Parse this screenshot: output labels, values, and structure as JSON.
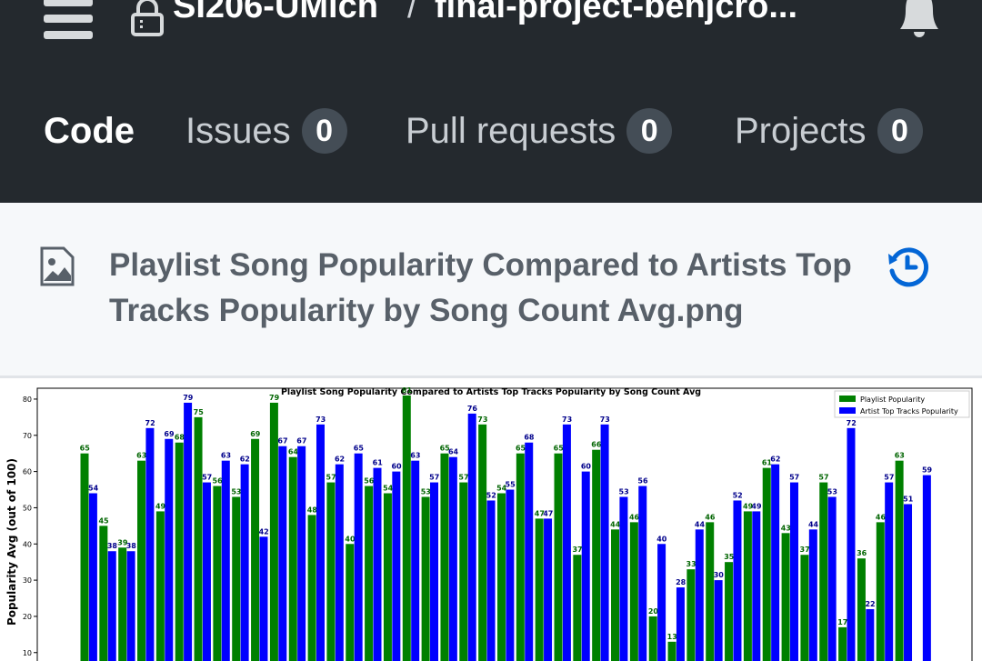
{
  "header": {
    "repo_owner": "SI206-UMich",
    "separator": "/",
    "repo_name": "final-project-benjcro..."
  },
  "tabs": [
    {
      "label": "Code",
      "active": true
    },
    {
      "label": "Issues",
      "count": "0"
    },
    {
      "label": "Pull requests",
      "count": "0"
    },
    {
      "label": "Projects",
      "count": "0"
    }
  ],
  "file": {
    "name": "Playlist Song Popularity Compared to Artists Top Tracks Popularity by Song Count Avg.png"
  },
  "colors": {
    "header_bg": "#24292e",
    "playlist_bar": "#008000",
    "artist_bar": "#0000ff",
    "history_icon": "#0366d6"
  },
  "chart_data": {
    "type": "bar",
    "title": "Playlist Song Popularity Compared to Artists Top Tracks Popularity by Song Count Avg",
    "ylabel": "Popularity Avg (out of 100)",
    "xlabel": "",
    "ylim": [
      10,
      83
    ],
    "yticks": [
      10,
      20,
      30,
      40,
      50,
      60,
      70,
      80
    ],
    "legend_position": "top-right",
    "grid": false,
    "series": [
      {
        "name": "Playlist Popularity",
        "color": "#008000",
        "values": [
          65,
          45,
          39,
          63,
          49,
          68,
          75,
          56,
          53,
          69,
          79,
          64,
          48,
          57,
          40,
          56,
          54,
          81,
          53,
          65,
          57,
          73,
          54,
          65,
          47,
          65,
          37,
          66,
          44,
          46,
          20,
          13,
          33,
          46,
          35,
          49,
          61,
          43,
          37,
          57,
          17,
          36,
          46,
          63
        ]
      },
      {
        "name": "Artist Top Tracks Popularity",
        "color": "#0000ff",
        "values": [
          54,
          38,
          38,
          72,
          69,
          79,
          57,
          63,
          62,
          42,
          67,
          67,
          73,
          62,
          65,
          61,
          60,
          63,
          57,
          64,
          76,
          52,
          55,
          68,
          47,
          73,
          60,
          73,
          53,
          56,
          40,
          28,
          44,
          30,
          52,
          49,
          62,
          57,
          44,
          53,
          72,
          22,
          57,
          51,
          59
        ]
      }
    ]
  }
}
